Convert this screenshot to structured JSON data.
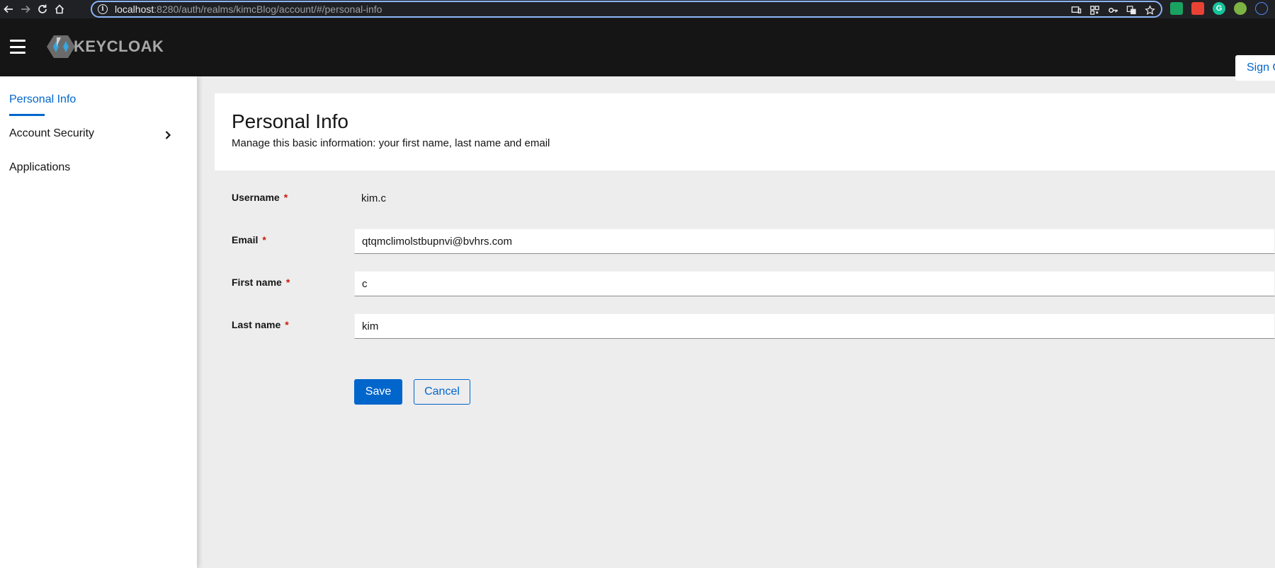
{
  "browser": {
    "url_host": "localhost",
    "url_rest": ":8280/auth/realms/kimcBlog/account/#/personal-info",
    "extension_colors": [
      "#1aa260",
      "#e94235",
      "#15c39a",
      "#7cb342",
      "#4d8bf5"
    ]
  },
  "header": {
    "logo_text": "KEYCLOAK",
    "signout_label": "Sign Out"
  },
  "sidebar": {
    "items": [
      {
        "label": "Personal Info",
        "active": true
      },
      {
        "label": "Account Security",
        "has_submenu": true
      },
      {
        "label": "Applications"
      }
    ]
  },
  "main": {
    "title": "Personal Info",
    "subtitle": "Manage this basic information: your first name, last name and email",
    "required_marker": "*",
    "fields": {
      "username": {
        "label": "Username",
        "value": "kim.c"
      },
      "email": {
        "label": "Email",
        "value": "qtqmclimolstbupnvi@bvhrs.com"
      },
      "first_name": {
        "label": "First name",
        "value": "c"
      },
      "last_name": {
        "label": "Last name",
        "value": "kim"
      }
    },
    "save_label": "Save",
    "cancel_label": "Cancel"
  },
  "colors": {
    "accent": "#0066cc",
    "header_bg": "#151515",
    "page_bg": "#ededed",
    "required": "#c9190b"
  }
}
